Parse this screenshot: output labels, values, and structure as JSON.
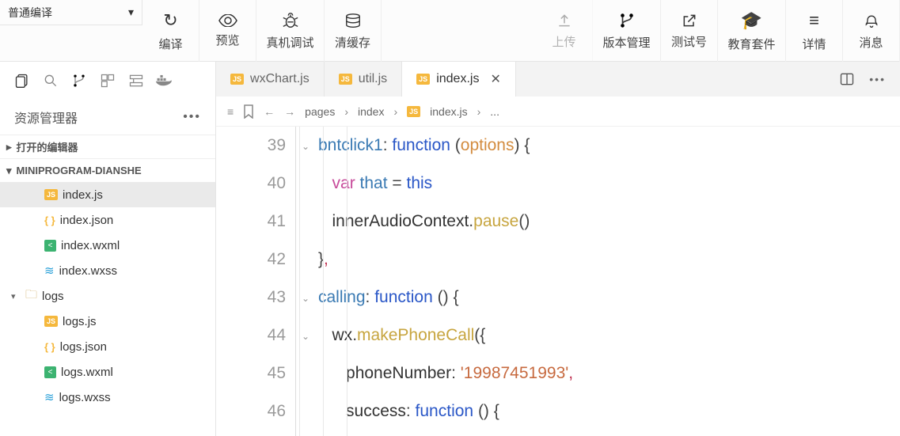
{
  "toolbar": {
    "compileMode": "普通编译",
    "buttons": [
      {
        "id": "compile",
        "label": "编译"
      },
      {
        "id": "preview",
        "label": "预览"
      },
      {
        "id": "remote",
        "label": "真机调试"
      },
      {
        "id": "clear",
        "label": "清缓存"
      }
    ],
    "rightButtons": [
      {
        "id": "upload",
        "label": "上传",
        "disabled": true
      },
      {
        "id": "vcs",
        "label": "版本管理"
      },
      {
        "id": "test",
        "label": "测试号"
      },
      {
        "id": "edu",
        "label": "教育套件"
      },
      {
        "id": "details",
        "label": "详情"
      },
      {
        "id": "msg",
        "label": "消息"
      }
    ]
  },
  "explorer": {
    "title": "资源管理器",
    "sections": {
      "openEditors": "打开的编辑器",
      "project": "MINIPROGRAM-DIANSHE"
    },
    "tree": [
      {
        "name": "index.js",
        "icon": "js",
        "selected": true,
        "indent": 1
      },
      {
        "name": "index.json",
        "icon": "json",
        "indent": 1
      },
      {
        "name": "index.wxml",
        "icon": "wxml",
        "indent": 1
      },
      {
        "name": "index.wxss",
        "icon": "wxss",
        "indent": 1
      },
      {
        "name": "logs",
        "icon": "folder",
        "indent": 0,
        "folder": true,
        "expanded": true
      },
      {
        "name": "logs.js",
        "icon": "js",
        "indent": 1
      },
      {
        "name": "logs.json",
        "icon": "json",
        "indent": 1
      },
      {
        "name": "logs.wxml",
        "icon": "wxml",
        "indent": 1
      },
      {
        "name": "logs.wxss",
        "icon": "wxss",
        "indent": 1
      }
    ]
  },
  "tabs": [
    {
      "label": "wxChart.js",
      "icon": "js"
    },
    {
      "label": "util.js",
      "icon": "js"
    },
    {
      "label": "index.js",
      "icon": "js",
      "active": true,
      "close": true
    }
  ],
  "breadcrumb": [
    "pages",
    "index",
    "index.js",
    "..."
  ],
  "code": {
    "startLine": 39,
    "lines": [
      {
        "n": 39,
        "fold": true,
        "tokens": [
          [
            "prop",
            "bntclick1"
          ],
          [
            "punc",
            ": "
          ],
          [
            "kw",
            "function "
          ],
          [
            "punc",
            "("
          ],
          [
            "param",
            "options"
          ],
          [
            "punc",
            ") "
          ],
          [
            "punc",
            "{"
          ]
        ]
      },
      {
        "n": 40,
        "indent": 1,
        "tokens": [
          [
            "kw2",
            "var "
          ],
          [
            "var",
            "that"
          ],
          [
            "punc",
            " = "
          ],
          [
            "this",
            "this"
          ]
        ]
      },
      {
        "n": 41,
        "indent": 1,
        "tokens": [
          [
            "ident",
            "innerAudioContext"
          ],
          [
            "punc",
            "."
          ],
          [
            "method",
            "pause"
          ],
          [
            "punc",
            "()"
          ]
        ]
      },
      {
        "n": 42,
        "tokens": [
          [
            "punc",
            "}"
          ],
          [
            "comma",
            ","
          ]
        ]
      },
      {
        "n": 43,
        "fold": true,
        "tokens": [
          [
            "prop",
            "calling"
          ],
          [
            "punc",
            ": "
          ],
          [
            "kw",
            "function "
          ],
          [
            "punc",
            "() "
          ],
          [
            "punc",
            "{"
          ]
        ]
      },
      {
        "n": 44,
        "fold": true,
        "indent": 1,
        "tokens": [
          [
            "ident",
            "wx"
          ],
          [
            "punc",
            "."
          ],
          [
            "method",
            "makePhoneCall"
          ],
          [
            "punc",
            "({"
          ]
        ]
      },
      {
        "n": 45,
        "indent": 2,
        "tokens": [
          [
            "ident",
            "phoneNumber"
          ],
          [
            "punc",
            ": "
          ],
          [
            "str",
            "'19987451993'"
          ],
          [
            "comma",
            ","
          ]
        ]
      },
      {
        "n": 46,
        "indent": 2,
        "tokens": [
          [
            "ident",
            "success"
          ],
          [
            "punc",
            ": "
          ],
          [
            "kw",
            "function "
          ],
          [
            "punc",
            "() "
          ],
          [
            "punc",
            "{"
          ]
        ]
      }
    ]
  }
}
